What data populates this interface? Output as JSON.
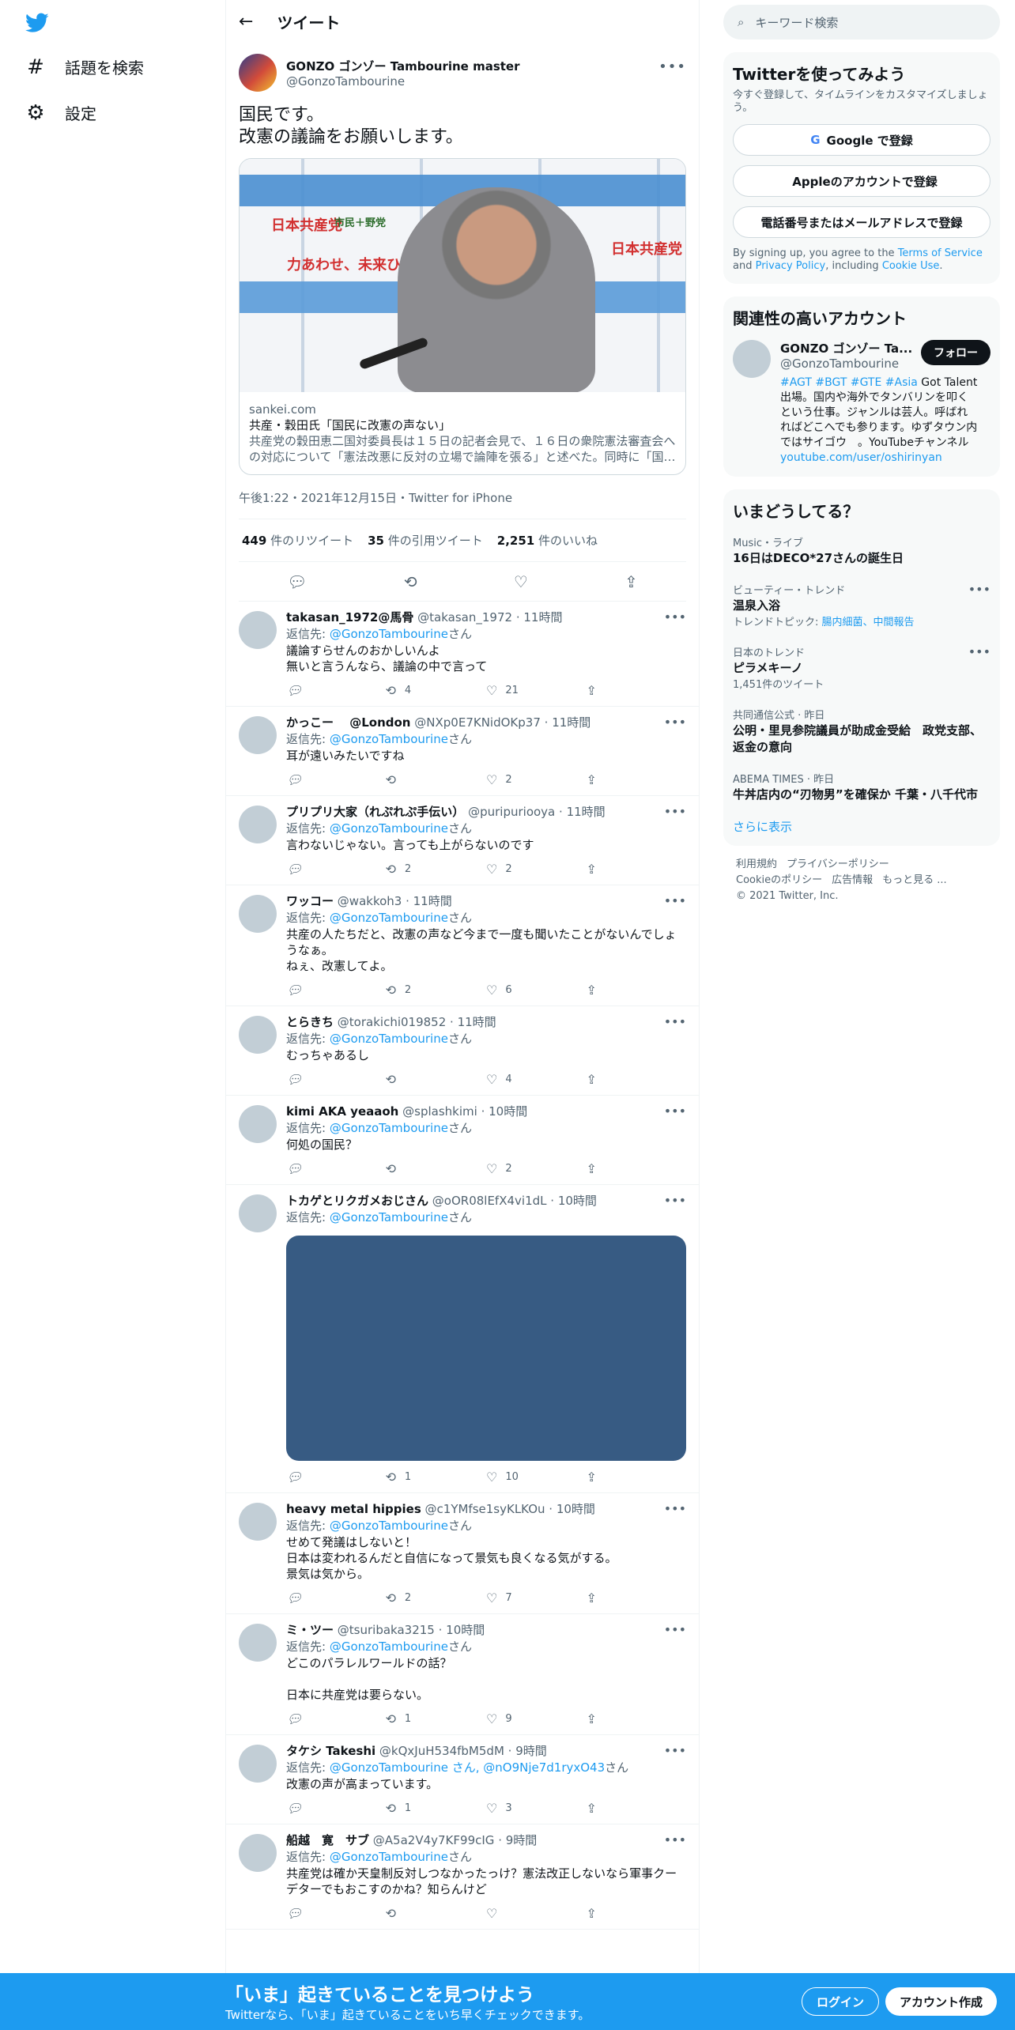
{
  "nav": {
    "explore": "話題を検索",
    "settings": "設定"
  },
  "header": {
    "back": "←",
    "title": "ツイート"
  },
  "tweet": {
    "name": "GONZO ゴンゾー Tambourine master",
    "handle": "@GonzoTambourine",
    "text": "国民です。\n改憲の議論をお願いします。",
    "card": {
      "domain": "sankei.com",
      "title": "共産・穀田氏「国民に改憲の声ない」",
      "desc": "共産党の穀田恵二国対委員長は１５日の記者会見で、１６日の衆院憲法審査会への対応について「憲法改悪に反対の立場で論陣を張る」と述べた。同時に「国…",
      "image_text": [
        "日本共産党",
        "力あわせ、未来ひらく。",
        "市民＋野党"
      ]
    },
    "meta": "午後1:22・2021年12月15日・Twitter for iPhone",
    "stats": [
      {
        "num": "449",
        "label": "件のリツイート"
      },
      {
        "num": "35",
        "label": "件の引用ツイート"
      },
      {
        "num": "2,251",
        "label": "件のいいね"
      }
    ]
  },
  "replies": [
    {
      "name": "takasan_1972@馬骨",
      "handle": "@takasan_1972",
      "time": "11時間",
      "to": "@GonzoTambourine",
      "suffix": "さん",
      "body": "議論すらせんのおかしいんよ\n無いと言うんなら、議論の中で言って",
      "rt": "4",
      "like": "21",
      "has_image": false
    },
    {
      "name": "かっこー　 @London",
      "handle": "@NXp0E7KNidOKp37",
      "time": "11時間",
      "to": "@GonzoTambourine",
      "suffix": "さん",
      "body": "耳が遠いみたいですね",
      "rt": "",
      "like": "2",
      "has_image": false
    },
    {
      "name": "プリプリ大家（れぷれぷ手伝い）",
      "handle": "@puripuriooya",
      "time": "11時間",
      "to": "@GonzoTambourine",
      "suffix": "さん",
      "body": "言わないじゃない。言っても上がらないのです",
      "rt": "2",
      "like": "2",
      "has_image": false
    },
    {
      "name": "ワッコー",
      "handle": "@wakkoh3",
      "time": "11時間",
      "to": "@GonzoTambourine",
      "suffix": "さん",
      "body": "共産の人たちだと、改憲の声など今まで一度も聞いたことがないんでしょうなぁ。\nねぇ、改憲してよ。",
      "rt": "2",
      "like": "6",
      "has_image": false
    },
    {
      "name": "とらきち",
      "handle": "@torakichi019852",
      "time": "11時間",
      "to": "@GonzoTambourine",
      "suffix": "さん",
      "body": "むっちゃあるし",
      "rt": "",
      "like": "4",
      "has_image": false
    },
    {
      "name": "kimi AKA yeaaoh",
      "handle": "@splashkimi",
      "time": "10時間",
      "to": "@GonzoTambourine",
      "suffix": "さん",
      "body": "何処の国民？",
      "rt": "",
      "like": "2",
      "has_image": false
    },
    {
      "name": "トカゲとリクガメおじさん",
      "handle": "@oOR08lEfX4vi1dL",
      "time": "10時間",
      "to": "@GonzoTambourine",
      "suffix": "さん",
      "body": "",
      "rt": "1",
      "like": "10",
      "has_image": true
    },
    {
      "name": "heavy metal hippies",
      "handle": "@c1YMfse1syKLKOu",
      "time": "10時間",
      "to": "@GonzoTambourine",
      "suffix": "さん",
      "body": "せめて発議はしないと！\n日本は変われるんだと自信になって景気も良くなる気がする。\n景気は気から。",
      "rt": "2",
      "like": "7",
      "has_image": false
    },
    {
      "name": "ミ・ツー",
      "handle": "@tsuribaka3215",
      "time": "10時間",
      "to": "@GonzoTambourine",
      "suffix": "さん",
      "body": "どこのパラレルワールドの話？\n\n日本に共産党は要らない。",
      "rt": "1",
      "like": "9",
      "has_image": false
    },
    {
      "name": "タケシ Takeshi",
      "handle": "@kQxJuH534fbM5dM",
      "time": "9時間",
      "to": "@GonzoTambourine さん, @nO9Nje7d1ryxO43",
      "suffix": "さん",
      "body": "改憲の声が高まっています。",
      "rt": "1",
      "like": "3",
      "has_image": false
    },
    {
      "name": "船越　寛　サブ",
      "handle": "@A5a2V4y7KF99cIG",
      "time": "9時間",
      "to": "@GonzoTambourine",
      "suffix": "さん",
      "body": "共産党は確か天皇制反対しつなかったっけ？憲法改正しないなら軍事クーデターでもおこすのかね？知らんけど",
      "rt": "",
      "like": "",
      "has_image": false
    }
  ],
  "sidebar": {
    "search_placeholder": "キーワード検索",
    "signup": {
      "title": "Twitterを使ってみよう",
      "sub": "今すぐ登録して、タイムラインをカスタマイズしましょう。",
      "google": "Google で登録",
      "apple": "Appleのアカウントで登録",
      "phone": "電話番号またはメールアドレスで登録",
      "terms_pre": "By signing up, you agree to the ",
      "terms": "Terms of Service",
      "and": " and ",
      "privacy": "Privacy Policy",
      "incl": ", including ",
      "cookie": "Cookie Use",
      "dot": "."
    },
    "related": {
      "title": "関連性の高いアカウント",
      "name": "GONZO ゴンゾー Ta...",
      "handle": "@GonzoTambourine",
      "follow": "フォロー",
      "tags": "#AGT #BGT #GTE #Asia",
      "bio": " Got Talent出場。国内や海外でタンバリンを叩くという仕事。ジャンルは芸人。呼ばれればどこへでも参ります。ゆずタウン内ではサイゴウ　。YouTubeチャンネル",
      "link": "youtube.com/user/oshirinyan"
    },
    "trends": {
      "title": "いまどうしてる？",
      "items": [
        {
          "cat": "Music・ライブ",
          "t": "16日はDECO*27さんの誕生日",
          "sub": ""
        },
        {
          "cat": "ビューティー・トレンド",
          "t": "温泉入浴",
          "sub": "トレンドトピック: ",
          "links": "腸内細菌、中間報告"
        },
        {
          "cat": "日本のトレンド",
          "t": "ピラメキーノ",
          "sub": "1,451件のツイート"
        },
        {
          "cat": "共同通信公式 · 昨日",
          "t": "公明・里見参院議員が助成金受給　政党支部、返金の意向",
          "sub": ""
        },
        {
          "cat": "ABEMA TIMES · 昨日",
          "t": "牛丼店内の“刃物男”を確保か 千葉・八千代市",
          "sub": ""
        }
      ],
      "more": "さらに表示"
    },
    "footer": [
      "利用規約",
      "プライバシーポリシー",
      "Cookieのポリシー",
      "広告情報",
      "もっと見る ...",
      "© 2021 Twitter, Inc."
    ]
  },
  "bottom": {
    "title": "「いま」起きていることを見つけよう",
    "sub": "Twitterなら、「いま」起きていることをいち早くチェックできます。",
    "login": "ログイン",
    "signup": "アカウント作成"
  },
  "colors": {
    "accent": "#1d9bf0",
    "text": "#0f1419",
    "muted": "#536471"
  }
}
